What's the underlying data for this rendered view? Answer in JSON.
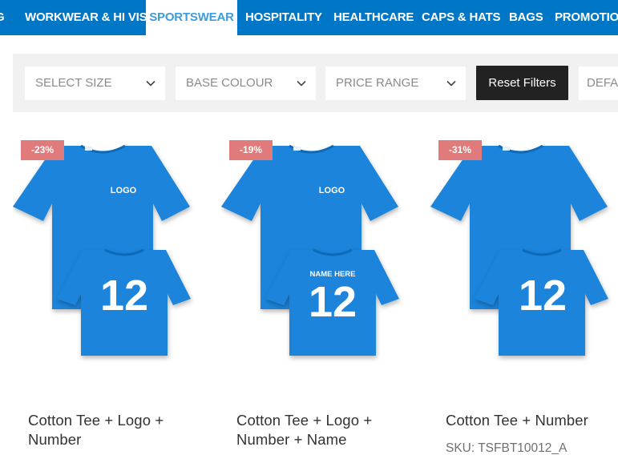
{
  "nav": {
    "items": [
      {
        "label": "G"
      },
      {
        "label": "WORKWEAR & HI VIS"
      },
      {
        "label": "SPORTSWEAR"
      },
      {
        "label": "HOSPITALITY"
      },
      {
        "label": "HEALTHCARE"
      },
      {
        "label": "CAPS & HATS"
      },
      {
        "label": "BAGS"
      },
      {
        "label": "PROMOTIO"
      }
    ],
    "active": "SPORTSWEAR"
  },
  "filters": {
    "size": "SELECT SIZE",
    "colour": "BASE COLOUR",
    "price": "PRICE RANGE",
    "reset": "Reset Filters",
    "sort": "DEFAU"
  },
  "products": [
    {
      "badge": "-23%",
      "title": "Cotton Tee + Logo + Number",
      "sku": "",
      "shirt_logo": "LOGO",
      "shirt_name": "",
      "shirt_number": "12"
    },
    {
      "badge": "-19%",
      "title": "Cotton Tee + Logo + Number + Name",
      "sku": "",
      "shirt_logo": "LOGO",
      "shirt_name": "NAME HERE",
      "shirt_number": "12"
    },
    {
      "badge": "-31%",
      "title": "Cotton Tee + Number",
      "sku": "SKU: TSFBT10012_A",
      "shirt_logo": "",
      "shirt_name": "",
      "shirt_number": "12"
    }
  ],
  "colors": {
    "nav_bg": "#0076c6",
    "nav_active_text": "#3d9cdb",
    "filter_bg": "#f1f1f1",
    "reset_bg": "#222222",
    "badge_bg": "#e17a7a",
    "shirt_blue": "#1b84db"
  }
}
